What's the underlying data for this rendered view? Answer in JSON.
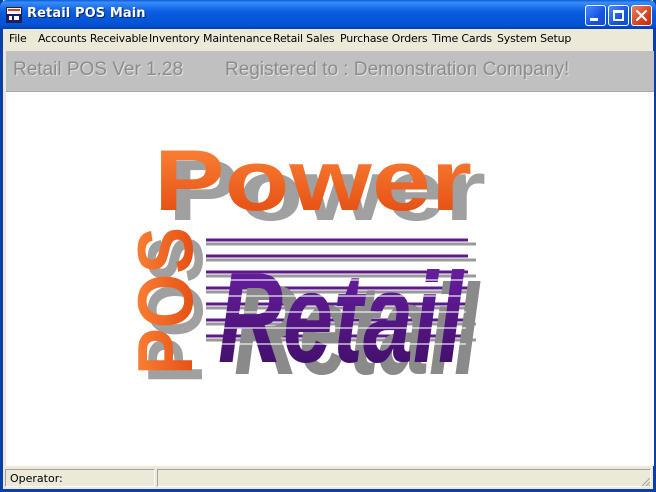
{
  "window": {
    "title": "Retail POS Main"
  },
  "menu": [
    "File",
    "Accounts Receivable",
    "Inventory Maintenance",
    "Retail Sales",
    "Purchase Orders",
    "Time Cards",
    "System Setup"
  ],
  "banner": {
    "version": "Retail POS Ver 1.28",
    "registered": "Registered to : Demonstration Company!"
  },
  "logo": {
    "word1": "Power",
    "word2": "Retail",
    "side": "POS"
  },
  "status": {
    "operator_label": "Operator:",
    "operator_value": ""
  },
  "colors": {
    "orange": "#f26a1b",
    "purple": "#5c1a8a",
    "shadow": "#9a9a9a",
    "titlebar": "#0a5ee0"
  }
}
